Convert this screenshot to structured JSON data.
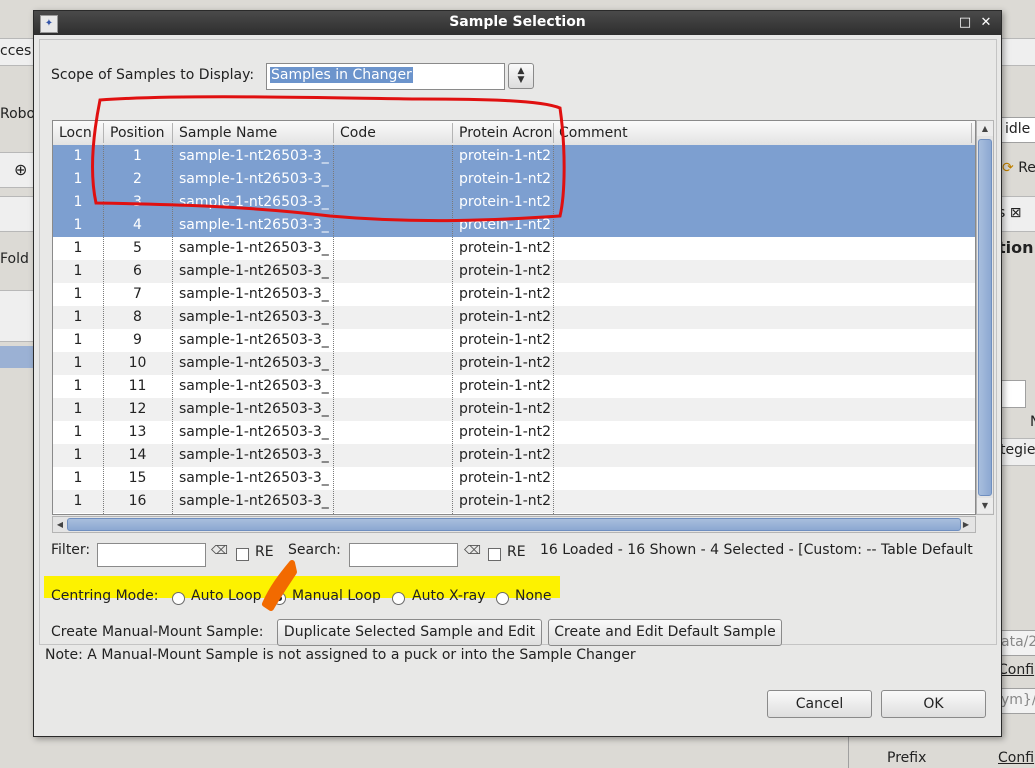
{
  "background": {
    "left_labels": [
      "cces",
      "Robot",
      "Fold"
    ],
    "right_status": "idle",
    "right_tab": "s",
    "right_heading": "tion",
    "right_partial": [
      "Re",
      "N",
      "tegie",
      "ata/2",
      "Confi",
      "ym}/",
      "Confi"
    ],
    "prefix_label": "Prefix"
  },
  "dialog": {
    "title": "Sample Selection",
    "scope_label": "Scope of Samples to Display:",
    "scope_value": "Samples in Changer",
    "table": {
      "columns": [
        "Locn",
        "Position",
        "Sample Name",
        "Code",
        "Protein Acron",
        "Comment"
      ],
      "rows": [
        {
          "locn": "1",
          "position": "1",
          "sample_name": "sample-1-nt26503-3_",
          "code": "",
          "protein": "protein-1-nt2",
          "comment": "",
          "selected": true
        },
        {
          "locn": "1",
          "position": "2",
          "sample_name": "sample-1-nt26503-3_",
          "code": "",
          "protein": "protein-1-nt2",
          "comment": "",
          "selected": true
        },
        {
          "locn": "1",
          "position": "3",
          "sample_name": "sample-1-nt26503-3_",
          "code": "",
          "protein": "protein-1-nt2",
          "comment": "",
          "selected": true
        },
        {
          "locn": "1",
          "position": "4",
          "sample_name": "sample-1-nt26503-3_",
          "code": "",
          "protein": "protein-1-nt2",
          "comment": "",
          "selected": true
        },
        {
          "locn": "1",
          "position": "5",
          "sample_name": "sample-1-nt26503-3_",
          "code": "",
          "protein": "protein-1-nt2",
          "comment": "",
          "selected": false
        },
        {
          "locn": "1",
          "position": "6",
          "sample_name": "sample-1-nt26503-3_",
          "code": "",
          "protein": "protein-1-nt2",
          "comment": "",
          "selected": false
        },
        {
          "locn": "1",
          "position": "7",
          "sample_name": "sample-1-nt26503-3_",
          "code": "",
          "protein": "protein-1-nt2",
          "comment": "",
          "selected": false
        },
        {
          "locn": "1",
          "position": "8",
          "sample_name": "sample-1-nt26503-3_",
          "code": "",
          "protein": "protein-1-nt2",
          "comment": "",
          "selected": false
        },
        {
          "locn": "1",
          "position": "9",
          "sample_name": "sample-1-nt26503-3_",
          "code": "",
          "protein": "protein-1-nt2",
          "comment": "",
          "selected": false
        },
        {
          "locn": "1",
          "position": "10",
          "sample_name": "sample-1-nt26503-3_",
          "code": "",
          "protein": "protein-1-nt2",
          "comment": "",
          "selected": false
        },
        {
          "locn": "1",
          "position": "11",
          "sample_name": "sample-1-nt26503-3_",
          "code": "",
          "protein": "protein-1-nt2",
          "comment": "",
          "selected": false
        },
        {
          "locn": "1",
          "position": "12",
          "sample_name": "sample-1-nt26503-3_",
          "code": "",
          "protein": "protein-1-nt2",
          "comment": "",
          "selected": false
        },
        {
          "locn": "1",
          "position": "13",
          "sample_name": "sample-1-nt26503-3_",
          "code": "",
          "protein": "protein-1-nt2",
          "comment": "",
          "selected": false
        },
        {
          "locn": "1",
          "position": "14",
          "sample_name": "sample-1-nt26503-3_",
          "code": "",
          "protein": "protein-1-nt2",
          "comment": "",
          "selected": false
        },
        {
          "locn": "1",
          "position": "15",
          "sample_name": "sample-1-nt26503-3_",
          "code": "",
          "protein": "protein-1-nt2",
          "comment": "",
          "selected": false
        },
        {
          "locn": "1",
          "position": "16",
          "sample_name": "sample-1-nt26503-3_",
          "code": "",
          "protein": "protein-1-nt2",
          "comment": "",
          "selected": false
        }
      ]
    },
    "filter_label": "Filter:",
    "filter_value": "",
    "filter_re_label": "RE",
    "search_label": "Search:",
    "search_value": "",
    "search_re_label": "RE",
    "status_text": "16 Loaded - 16 Shown - 4 Selected -  [Custom: -- Table Default",
    "centring_label": "Centring Mode:",
    "centring_options": [
      {
        "label": "Auto Loop",
        "selected": false
      },
      {
        "label": "Manual Loop",
        "selected": true
      },
      {
        "label": "Auto X-ray",
        "selected": false
      },
      {
        "label": "None",
        "selected": false
      }
    ],
    "manual_mount_label": "Create Manual-Mount Sample:",
    "duplicate_button": "Duplicate Selected Sample and Edit",
    "create_default_button": "Create and Edit Default Sample",
    "note": "Note: A Manual-Mount Sample is not assigned to a puck or into the Sample Changer",
    "cancel_button": "Cancel",
    "ok_button": "OK"
  },
  "colors": {
    "selection": "#7d9fd0",
    "highlight": "#fdf200",
    "annotation_red": "#e01010",
    "annotation_orange": "#f26a00"
  }
}
